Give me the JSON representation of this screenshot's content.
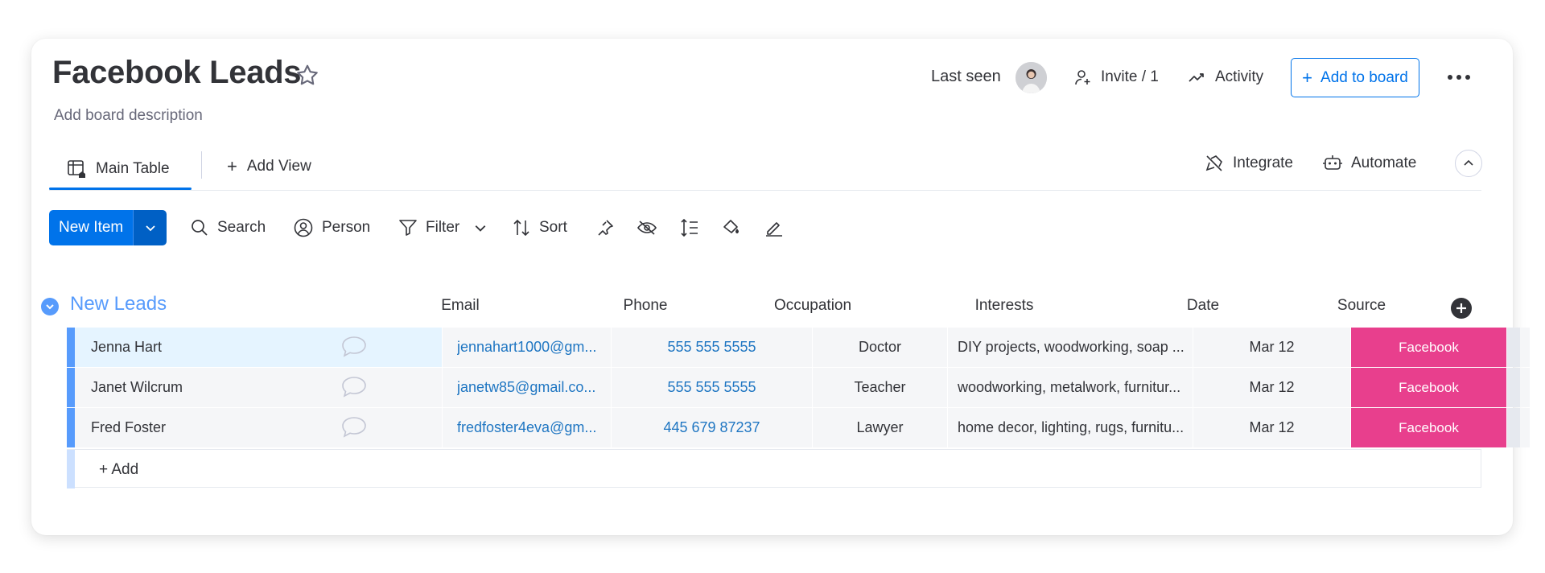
{
  "board": {
    "title": "Facebook Leads",
    "description": "Add board description"
  },
  "header": {
    "last_seen": "Last seen",
    "invite": "Invite / 1",
    "activity": "Activity",
    "add_to_board": "Add to board"
  },
  "views": {
    "main_table": "Main Table",
    "add_view": "Add View",
    "integrate": "Integrate",
    "automate": "Automate"
  },
  "toolbar": {
    "new_item": "New Item",
    "search": "Search",
    "person": "Person",
    "filter": "Filter",
    "sort": "Sort"
  },
  "group": {
    "title": "New Leads",
    "color": "#579bfc",
    "columns": [
      "Email",
      "Phone",
      "Occupation",
      "Interests",
      "Date",
      "Source"
    ],
    "rows": [
      {
        "name": "Jenna Hart",
        "email": "jennahart1000@gm...",
        "phone": "555 555 5555",
        "occupation": "Doctor",
        "interests": "DIY projects, woodworking, soap ...",
        "date": "Mar 12",
        "source": "Facebook"
      },
      {
        "name": "Janet Wilcrum",
        "email": "janetw85@gmail.co...",
        "phone": "555 555 5555",
        "occupation": "Teacher",
        "interests": "woodworking, metalwork, furnitur...",
        "date": "Mar 12",
        "source": "Facebook"
      },
      {
        "name": "Fred Foster",
        "email": "fredfoster4eva@gm...",
        "phone": "445 679 87237",
        "occupation": "Lawyer",
        "interests": "home decor, lighting, rugs, furnitu...",
        "date": "Mar 12",
        "source": "Facebook"
      }
    ],
    "add_row": "+ Add"
  },
  "colors": {
    "primary": "#0073ea",
    "source_facebook": "#e83f8d",
    "link": "#1f76c2"
  }
}
